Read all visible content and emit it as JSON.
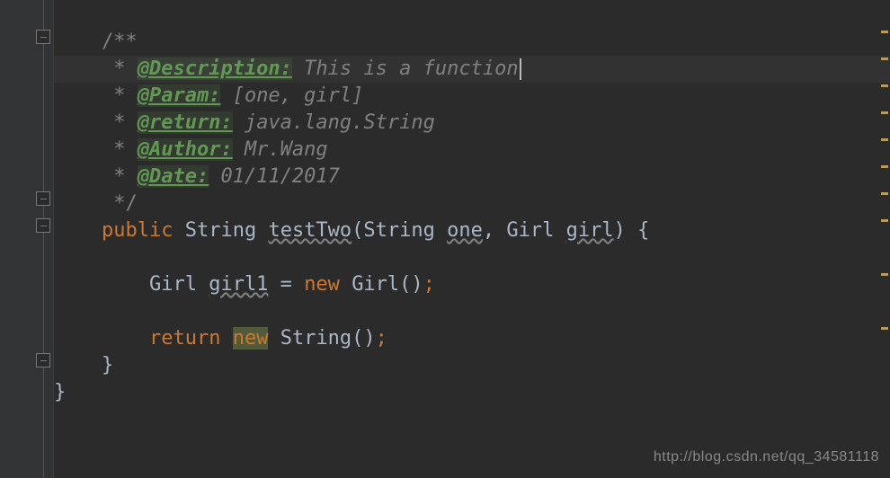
{
  "javadoc": {
    "open": "/**",
    "descriptionTag": "@Description:",
    "descriptionText": " This is a function",
    "paramTag": "@Param:",
    "paramText": " [one, girl]",
    "returnTag": "@return:",
    "returnText": " java.lang.String",
    "authorTag": "@Author:",
    "authorText": " Mr.Wang",
    "dateTag": "@Date:",
    "dateText": " 01/11/2017",
    "close": " */"
  },
  "code": {
    "publicKw": "public",
    "typeString": "String",
    "methodName": "testTwo",
    "paramOne": "one",
    "typeGirl": "Girl",
    "paramGirl": "girl",
    "localGirl1": "girl1",
    "eq": " = ",
    "newKw": "new",
    "girlCtor": "Girl()",
    "returnKw": "return",
    "stringCtor": "String()",
    "openBrace": " {",
    "closeBrace": "}",
    "semi": ";",
    "comma": ", ",
    "lparen": "(",
    "rparen": ")"
  },
  "star": " * ",
  "watermark": "http://blog.csdn.net/qq_34581118"
}
